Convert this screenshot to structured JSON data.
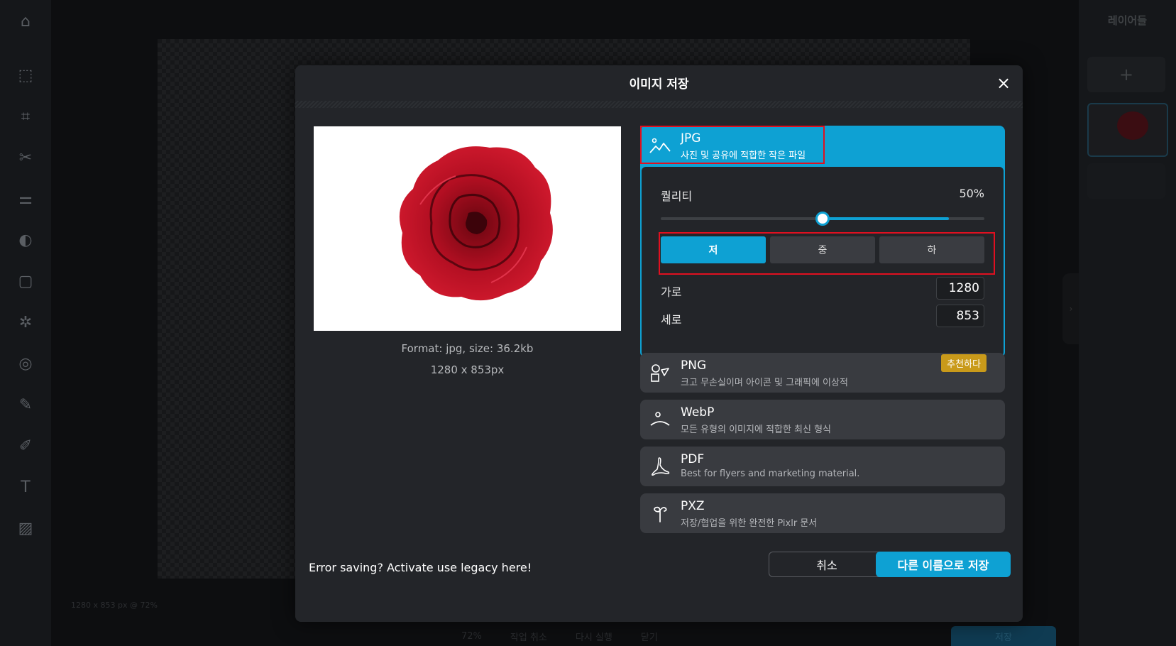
{
  "app": {
    "layers_title": "레이어들",
    "status_text": "1280 x 853 px @ 72%",
    "bottom_bar": [
      "72%",
      "작업 취소",
      "다시 실행",
      "닫기"
    ],
    "save_label": "저장"
  },
  "sidebar_icons": [
    "home-icon",
    "select-icon",
    "crop-icon",
    "cut-icon",
    "adjust-icon",
    "filter-icon",
    "frame-icon",
    "effect-icon",
    "liquify-icon",
    "brush-icon",
    "retouch-icon",
    "text-icon",
    "pattern-icon"
  ],
  "dialog": {
    "title": "이미지 저장",
    "preview": {
      "format_info": "Format: jpg, size: 36.2kb",
      "dimensions_info": "1280 x 853px"
    },
    "formats": [
      {
        "name": "JPG",
        "desc": "사진 및 공유에 적합한 작은 파일",
        "icon": "landscape-icon",
        "selected": true
      },
      {
        "name": "PNG",
        "desc": "크고 무손실이며 아이콘 및 그래픽에 이상적",
        "icon": "shapes-icon",
        "badge": "추천하다"
      },
      {
        "name": "WebP",
        "desc": "모든 유형의 이미지에 적합한 최신 형식",
        "icon": "webp-icon"
      },
      {
        "name": "PDF",
        "desc": "Best for flyers and marketing material.",
        "icon": "pdf-icon"
      },
      {
        "name": "PXZ",
        "desc": "저장/협업을 위한 완전한 Pixlr 문서",
        "icon": "pxz-icon"
      }
    ],
    "quality": {
      "label": "퀄리티",
      "value_text": "50%",
      "value": 0.5,
      "buffer": 0.89,
      "presets": [
        "저",
        "중",
        "하"
      ],
      "active_preset": "저"
    },
    "size": {
      "width_label": "가로",
      "width": "1280",
      "height_label": "세로",
      "height": "853"
    },
    "legacy_text": "Error saving? Activate use legacy here!",
    "cancel_label": "취소",
    "save_as_label": "다른 이름으로 저장",
    "accent_color": "#0ea1d3",
    "badge_color": "#c99a1a"
  }
}
